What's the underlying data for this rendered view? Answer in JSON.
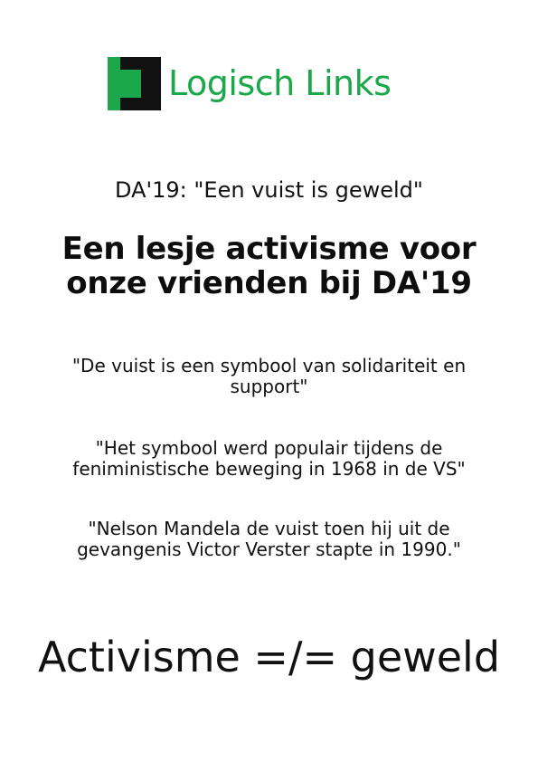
{
  "logo": {
    "text": "Logisch Links",
    "colors": {
      "green": "#1aa84a",
      "black": "#111111"
    }
  },
  "subtitle": "DA'19: \"Een vuist is geweld\"",
  "headline": {
    "line1": "Een lesje activisme voor",
    "line2": "onze vrienden bij DA'19"
  },
  "quotes": [
    {
      "line1": "\"De vuist is een symbool van solidariteit en",
      "line2": "support\""
    },
    {
      "line1": "\"Het symbool werd populair tijdens de",
      "line2": "feniministische beweging in 1968 in de VS\""
    },
    {
      "line1": "\"Nelson Mandela de vuist toen hij uit de",
      "line2": "gevangenis Victor Verster stapte in 1990.\""
    }
  ],
  "slogan": "Activisme =/= geweld"
}
